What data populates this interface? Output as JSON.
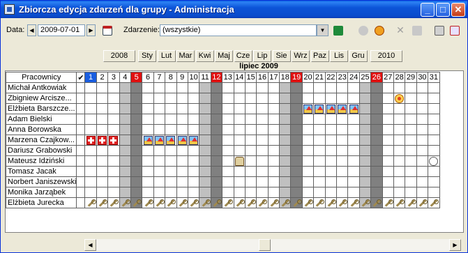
{
  "window": {
    "title": "Zbiorcza edycja zdarzeń dla grupy  - Administracja"
  },
  "toolbar": {
    "date_label": "Data:",
    "date_value": "2009-07-01",
    "event_label": "Zdarzenie:",
    "event_value": "(wszystkie)"
  },
  "nav": {
    "prev_year": "2008",
    "months": [
      "Sty",
      "Lut",
      "Mar",
      "Kwi",
      "Maj",
      "Cze",
      "Lip",
      "Sie",
      "Wrz",
      "Paz",
      "Lis",
      "Gru"
    ],
    "next_year": "2010"
  },
  "month_title": "lipiec 2009",
  "grid": {
    "header_name": "Pracownicy",
    "header_check": "✔",
    "days": 31,
    "today": 1,
    "saturdays": [
      4,
      11,
      18,
      25
    ],
    "sundays": [
      5,
      12,
      19,
      26
    ],
    "employees": [
      {
        "name": "Michał Antkowiak",
        "events": {}
      },
      {
        "name": "Zbigniew Arcisze...",
        "events": {
          "28": "clock"
        }
      },
      {
        "name": "Elżbieta Barszcze...",
        "events": {
          "20": "vacation",
          "21": "vacation",
          "22": "vacation",
          "23": "vacation",
          "24": "vacation"
        }
      },
      {
        "name": "Adam Bielski",
        "events": {}
      },
      {
        "name": "Anna Borowska",
        "events": {}
      },
      {
        "name": "Marzena Czajkow...",
        "events": {
          "1": "medical",
          "2": "medical",
          "3": "medical",
          "6": "vacation",
          "7": "vacation",
          "8": "vacation",
          "9": "vacation",
          "10": "vacation"
        }
      },
      {
        "name": "Dariusz Grabowski",
        "events": {}
      },
      {
        "name": "Mateusz Idziński",
        "events": {
          "14": "car",
          "31": "link"
        }
      },
      {
        "name": "Tomasz Jacak",
        "events": {}
      },
      {
        "name": "Norbert Janiszewski",
        "events": {}
      },
      {
        "name": "Monika Jarząbek",
        "events": {}
      },
      {
        "name": "Elżbieta Jurecka",
        "events": {
          "all": "tool"
        }
      }
    ]
  }
}
